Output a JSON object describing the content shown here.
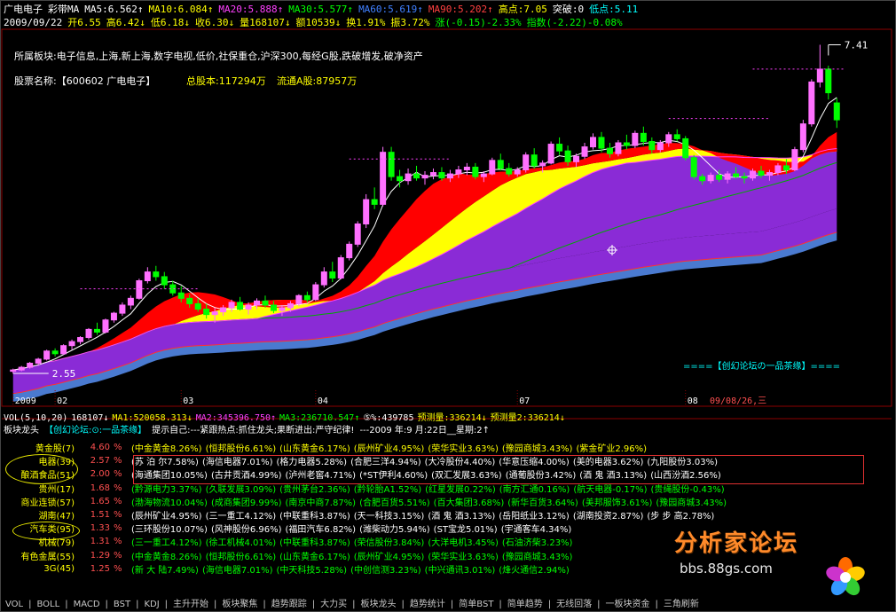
{
  "header": {
    "line1": [
      {
        "text": "广电电子",
        "color": "#ffffff"
      },
      {
        "text": "彩带MA",
        "color": "#ffffff"
      },
      {
        "text": "MA5:6.562↑",
        "color": "#ffffff"
      },
      {
        "text": "MA10:6.084↑",
        "color": "#ffff00"
      },
      {
        "text": "MA20:5.888↑",
        "color": "#ff40ff"
      },
      {
        "text": "MA30:5.577↑",
        "color": "#00ff00"
      },
      {
        "text": "MA60:5.619↑",
        "color": "#4080ff"
      },
      {
        "text": "MA90:5.202↑",
        "color": "#ff4040"
      },
      {
        "text": "高点:7.05",
        "color": "#ffff00"
      },
      {
        "text": "突破:0",
        "color": "#ffffff"
      },
      {
        "text": "低点:5.11",
        "color": "#00ffff"
      }
    ],
    "line2": [
      {
        "text": "2009/09/22",
        "color": "#ffffff"
      },
      {
        "text": "开6.55",
        "color": "#ffff00"
      },
      {
        "text": "高6.42↓",
        "color": "#ffff00"
      },
      {
        "text": "低6.18↓",
        "color": "#ffff00"
      },
      {
        "text": "收6.30↓",
        "color": "#ffff00"
      },
      {
        "text": "量168107↓",
        "color": "#ffff00"
      },
      {
        "text": "额10539↓",
        "color": "#ffff00"
      },
      {
        "text": "换1.91%",
        "color": "#ffff00"
      },
      {
        "text": "振3.72%",
        "color": "#ffff00"
      },
      {
        "text": "涨(-0.15)-2.33%",
        "color": "#00ff00"
      },
      {
        "text": "指数(-2.22)-0.08%",
        "color": "#00ff00"
      }
    ],
    "sector_line": "所属板块:电子信息,上海,新上海,数字电视,低价,社保重仓,沪深300,每经G股,跌破增发,破净资产",
    "stock_name": "股票名称:【600602 广电电子】",
    "total_shares": "总股本:117294万",
    "float_shares": "流通A股:87957万",
    "forum_note": "====【创幻论坛の一品茶缘】===="
  },
  "chart_data": {
    "type": "candlestick",
    "title": "广电电子 彩带MA",
    "x_ticks": [
      "2009",
      "02",
      "03",
      "04",
      "07",
      "08"
    ],
    "date_label": "09/08/26,三",
    "price_high_marker": 7.41,
    "price_low_marker": 2.55,
    "ylim": [
      2.3,
      7.6
    ],
    "candles": [
      [
        2.6,
        2.62,
        2.55,
        2.6
      ],
      [
        2.6,
        2.66,
        2.58,
        2.64
      ],
      [
        2.64,
        2.72,
        2.62,
        2.7
      ],
      [
        2.7,
        2.78,
        2.66,
        2.76
      ],
      [
        2.76,
        2.9,
        2.74,
        2.88
      ],
      [
        2.88,
        2.92,
        2.8,
        2.84
      ],
      [
        2.84,
        2.98,
        2.82,
        2.96
      ],
      [
        2.96,
        3.05,
        2.9,
        3.02
      ],
      [
        3.02,
        3.1,
        2.98,
        3.08
      ],
      [
        3.08,
        3.22,
        3.05,
        3.2
      ],
      [
        3.2,
        3.3,
        3.12,
        3.16
      ],
      [
        3.16,
        3.36,
        3.14,
        3.34
      ],
      [
        3.34,
        3.46,
        3.3,
        3.44
      ],
      [
        3.44,
        3.6,
        3.4,
        3.56
      ],
      [
        3.56,
        3.7,
        3.5,
        3.66
      ],
      [
        3.66,
        3.95,
        3.64,
        3.92
      ],
      [
        3.92,
        4.12,
        3.88,
        4.05
      ],
      [
        4.05,
        4.14,
        3.92,
        3.98
      ],
      [
        3.98,
        4.05,
        3.8,
        3.86
      ],
      [
        3.86,
        3.92,
        3.7,
        3.74
      ],
      [
        3.74,
        3.84,
        3.6,
        3.66
      ],
      [
        3.66,
        3.72,
        3.52,
        3.58
      ],
      [
        3.58,
        3.66,
        3.46,
        3.5
      ],
      [
        3.5,
        3.58,
        3.36,
        3.42
      ],
      [
        3.42,
        3.52,
        3.3,
        3.46
      ],
      [
        3.46,
        3.56,
        3.4,
        3.52
      ],
      [
        3.52,
        3.64,
        3.46,
        3.6
      ],
      [
        3.6,
        3.68,
        3.48,
        3.5
      ],
      [
        3.5,
        3.6,
        3.42,
        3.56
      ],
      [
        3.56,
        3.66,
        3.5,
        3.62
      ],
      [
        3.62,
        3.7,
        3.52,
        3.56
      ],
      [
        3.56,
        3.62,
        3.44,
        3.48
      ],
      [
        3.48,
        3.56,
        3.4,
        3.52
      ],
      [
        3.52,
        3.62,
        3.46,
        3.58
      ],
      [
        3.58,
        3.72,
        3.54,
        3.7
      ],
      [
        3.7,
        3.76,
        3.6,
        3.64
      ],
      [
        3.64,
        3.9,
        3.62,
        3.86
      ],
      [
        3.86,
        4.12,
        3.82,
        4.05
      ],
      [
        4.05,
        4.2,
        3.9,
        3.96
      ],
      [
        3.96,
        4.3,
        3.94,
        4.26
      ],
      [
        4.26,
        4.5,
        4.22,
        4.46
      ],
      [
        4.46,
        4.8,
        4.42,
        4.76
      ],
      [
        4.76,
        5.2,
        4.7,
        5.12
      ],
      [
        5.12,
        5.3,
        4.98,
        5.05
      ],
      [
        5.05,
        5.9,
        5.02,
        5.82
      ],
      [
        5.82,
        5.9,
        5.4,
        5.46
      ],
      [
        5.46,
        5.56,
        5.3,
        5.4
      ],
      [
        5.4,
        5.58,
        5.34,
        5.5
      ],
      [
        5.5,
        5.62,
        5.4,
        5.44
      ],
      [
        5.44,
        5.54,
        5.34,
        5.48
      ],
      [
        5.48,
        5.58,
        5.42,
        5.52
      ],
      [
        5.52,
        5.6,
        5.4,
        5.44
      ],
      [
        5.44,
        5.56,
        5.38,
        5.5
      ],
      [
        5.5,
        5.62,
        5.44,
        5.56
      ],
      [
        5.56,
        5.66,
        5.48,
        5.6
      ],
      [
        5.6,
        5.66,
        5.42,
        5.46
      ],
      [
        5.46,
        5.54,
        5.38,
        5.5
      ],
      [
        5.5,
        5.74,
        5.48,
        5.7
      ],
      [
        5.7,
        5.8,
        5.55,
        5.58
      ],
      [
        5.58,
        5.66,
        5.46,
        5.5
      ],
      [
        5.5,
        5.6,
        5.46,
        5.56
      ],
      [
        5.56,
        5.82,
        5.52,
        5.78
      ],
      [
        5.78,
        5.88,
        5.58,
        5.62
      ],
      [
        5.62,
        5.7,
        5.52,
        5.66
      ],
      [
        5.66,
        5.98,
        5.64,
        5.94
      ],
      [
        5.94,
        6.04,
        5.78,
        5.84
      ],
      [
        5.84,
        5.92,
        5.62,
        5.68
      ],
      [
        5.68,
        5.8,
        5.6,
        5.76
      ],
      [
        5.76,
        5.96,
        5.72,
        5.9
      ],
      [
        5.9,
        6.1,
        5.86,
        6.04
      ],
      [
        6.04,
        6.12,
        5.82,
        5.88
      ],
      [
        5.88,
        5.96,
        5.74,
        5.8
      ],
      [
        5.8,
        6.0,
        5.76,
        5.96
      ],
      [
        5.96,
        6.08,
        5.86,
        5.92
      ],
      [
        5.92,
        6.14,
        5.88,
        6.1
      ],
      [
        6.1,
        6.2,
        5.92,
        5.98
      ],
      [
        5.98,
        6.04,
        5.8,
        5.86
      ],
      [
        5.86,
        6.0,
        5.82,
        5.96
      ],
      [
        5.96,
        6.12,
        5.9,
        6.08
      ],
      [
        6.08,
        6.16,
        5.98,
        6.02
      ],
      [
        6.02,
        6.06,
        5.7,
        5.74
      ],
      [
        5.74,
        5.78,
        5.42,
        5.46
      ],
      [
        5.46,
        5.5,
        5.34,
        5.4
      ],
      [
        5.4,
        5.52,
        5.36,
        5.48
      ],
      [
        5.48,
        5.56,
        5.38,
        5.42
      ],
      [
        5.42,
        5.54,
        5.36,
        5.5
      ],
      [
        5.5,
        5.6,
        5.44,
        5.46
      ],
      [
        5.46,
        5.52,
        5.36,
        5.44
      ],
      [
        5.44,
        5.58,
        5.4,
        5.54
      ],
      [
        5.54,
        5.62,
        5.44,
        5.48
      ],
      [
        5.48,
        5.56,
        5.4,
        5.52
      ],
      [
        5.52,
        5.66,
        5.48,
        5.62
      ],
      [
        5.62,
        5.72,
        5.5,
        5.56
      ],
      [
        5.56,
        5.9,
        5.54,
        5.86
      ],
      [
        5.86,
        6.3,
        5.82,
        6.24
      ],
      [
        6.24,
        6.9,
        6.2,
        6.86
      ],
      [
        6.86,
        7.41,
        6.78,
        7.05
      ],
      [
        7.05,
        7.1,
        6.6,
        6.7
      ],
      [
        6.55,
        6.62,
        6.18,
        6.3
      ]
    ]
  },
  "volume_line": [
    {
      "text": "VOL(5,10,20)",
      "color": "#ffffff"
    },
    {
      "text": "168107↓",
      "color": "#ffffff"
    },
    {
      "text": "MA1:520058.313↓",
      "color": "#ffff00"
    },
    {
      "text": "MA2:345396.750↑",
      "color": "#ff40ff"
    },
    {
      "text": "MA3:236710.547↑",
      "color": "#00ff00"
    },
    {
      "text": "⑤%:439785",
      "color": "#ffffff"
    },
    {
      "text": "预测量:336214↓",
      "color": "#ffff00"
    },
    {
      "text": "预测量2:336214↓",
      "color": "#ffff00"
    }
  ],
  "sector_bar": [
    {
      "text": "板块龙头",
      "color": "#ffffff"
    },
    {
      "text": "【创幻论坛:⊙:一品茶缘】",
      "color": "#00ffff"
    },
    {
      "text": "提示自己:---紧跟热点:抓住龙头;果断进出:严守纪律!",
      "color": "#ffffff"
    },
    {
      "text": "---2009 年:9 月:22日__星期:2↑",
      "color": "#ffffff"
    }
  ],
  "sectors": [
    {
      "name": "黄金股(7)",
      "chg": "4.60",
      "stocks": [
        "(中金黄金8.26%)",
        "(恒邦股份6.61%)",
        "(山东黄金6.17%)",
        "(辰州矿业4.95%)",
        "(荣华实业3.63%)",
        "(豫园商城3.43%)",
        "(紫金矿业2.96%)"
      ],
      "color": "#ffff00"
    },
    {
      "name": "电器(39)",
      "chg": "2.57",
      "stocks": [
        "(苏 泊 尔7.58%)",
        "(海信电器7.01%)",
        "(格力电器5.28%)",
        "(合肥三洋4.94%)",
        "(大冷股份4.40%)",
        "(华意压缩4.00%)",
        "(美的电器3.62%)",
        "(九阳股份3.03%)"
      ],
      "color": "#ffffff"
    },
    {
      "name": "酿酒食品(51)",
      "chg": "2.00",
      "stocks": [
        "(海通集团10.05%)",
        "(古井贡酒4.99%)",
        "(泸州老窖4.71%)",
        "(*ST伊利4.60%)",
        "(双汇发展3.63%)",
        "(通葡股份3.42%)",
        "(酒 鬼 酒3.13%)",
        "(山西汾酒2.56%)"
      ],
      "color": "#ffffff"
    },
    {
      "name": "贵州(17)",
      "chg": "1.68",
      "stocks": [
        "(黔源电力3.37%)",
        "(久联发展3.09%)",
        "(贵州茅台2.36%)",
        "(黔轮胎A1.52%)",
        "(红星发展0.22%)",
        "(南方汇通0.16%)",
        "(航天电器-0.17%)",
        "(贵绳股份-0.43%)"
      ],
      "color": "#00ff00"
    },
    {
      "name": "商业连锁(57)",
      "chg": "1.65",
      "stocks": [
        "(渤海物流10.04%)",
        "(成商集团9.99%)",
        "(南京中商7.87%)",
        "(合肥百货5.51%)",
        "(百大集团3.68%)",
        "(新华百货3.64%)",
        "(美邦服饰3.61%)",
        "(豫园商城3.43%)"
      ],
      "color": "#00ff00"
    },
    {
      "name": "湖南(47)",
      "chg": "1.51",
      "stocks": [
        "(辰州矿业4.95%)",
        "(三一重工4.12%)",
        "(中联重科3.87%)",
        "(天一科技3.15%)",
        "(酒 鬼 酒3.13%)",
        "(岳阳纸业3.12%)",
        "(湖南投资2.87%)",
        "(步 步 高2.78%)"
      ],
      "color": "#ffffff"
    },
    {
      "name": "汽车类(95)",
      "chg": "1.33",
      "stocks": [
        "(三环股份10.07%)",
        "(风神股份6.96%)",
        "(福田汽车6.82%)",
        "(潍柴动力5.94%)",
        "(ST宝龙5.01%)",
        "(宇通客车4.34%)"
      ],
      "color": "#ffffff"
    },
    {
      "name": "机械(79)",
      "chg": "1.31",
      "stocks": [
        "(三一重工4.12%)",
        "(徐工机械4.01%)",
        "(中联重科3.87%)",
        "(荣信股份3.84%)",
        "(大洋电机3.45%)",
        "(石油济柴3.23%)"
      ],
      "color": "#00ff00"
    },
    {
      "name": "有色金属(55)",
      "chg": "1.29",
      "stocks": [
        "(中金黄金8.26%)",
        "(恒邦股份6.61%)",
        "(山东黄金6.17%)",
        "(辰州矿业4.95%)",
        "(荣华实业3.63%)",
        "(豫园商城3.43%)"
      ],
      "color": "#00ff00"
    },
    {
      "name": "3G(45)",
      "chg": "1.25",
      "stocks": [
        "(新 大 陆7.49%)",
        "(海信电器7.01%)",
        "(中天科技5.28%)",
        "(中创信测3.23%)",
        "(中兴通讯3.01%)",
        "(烽火通信2.94%)"
      ],
      "color": "#00ff00"
    }
  ],
  "watermark": {
    "title": "分析家论坛",
    "url": "bbs.88gs.com"
  },
  "toolbar": [
    "VOL",
    "BOLL",
    "MACD",
    "BST",
    "KDJ",
    "主升开始",
    "板块聚焦",
    "趋势跟踪",
    "大力买",
    "板块龙头",
    "趋势统计",
    "简单BST",
    "简单趋势",
    "无线回落",
    "一板块资金",
    "三角刷新"
  ],
  "colors": {
    "up": "#ff70ff",
    "down": "#00ff00",
    "red_band": "#ff0000",
    "yellow_band": "#ffff00",
    "purple_band": "#8a2bd6"
  }
}
